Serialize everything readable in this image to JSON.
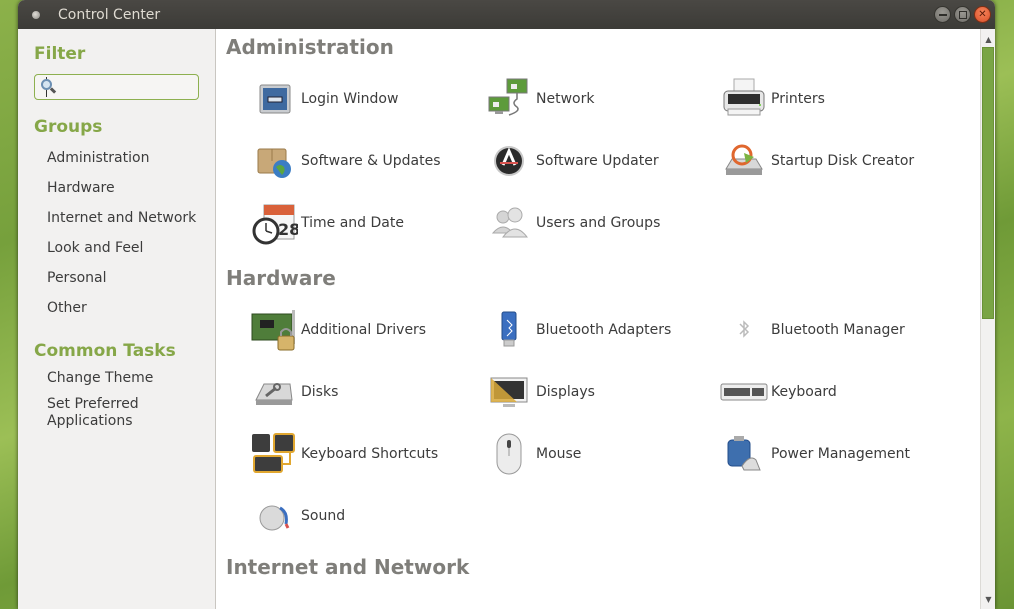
{
  "window": {
    "title": "Control Center",
    "buttons": {
      "minimize": "minimize",
      "maximize": "maximize",
      "close": "close"
    }
  },
  "sidebar": {
    "filter_heading": "Filter",
    "search": {
      "value": "",
      "placeholder": ""
    },
    "groups_heading": "Groups",
    "groups": [
      {
        "label": "Administration"
      },
      {
        "label": "Hardware"
      },
      {
        "label": "Internet and Network"
      },
      {
        "label": "Look and Feel"
      },
      {
        "label": "Personal"
      },
      {
        "label": "Other"
      }
    ],
    "tasks_heading": "Common Tasks",
    "tasks": [
      {
        "label": "Change Theme"
      },
      {
        "label": "Set Preferred Applications"
      }
    ]
  },
  "sections": {
    "administration": {
      "title": "Administration",
      "items": [
        {
          "label": "Login Window",
          "icon": "login-window-icon"
        },
        {
          "label": "Network",
          "icon": "network-icon"
        },
        {
          "label": "Printers",
          "icon": "printer-icon"
        },
        {
          "label": "Software & Updates",
          "icon": "software-updates-icon"
        },
        {
          "label": "Software Updater",
          "icon": "software-updater-icon"
        },
        {
          "label": "Startup Disk Creator",
          "icon": "startup-disk-icon"
        },
        {
          "label": "Time and Date",
          "icon": "time-date-icon"
        },
        {
          "label": "Users and Groups",
          "icon": "users-groups-icon"
        }
      ]
    },
    "hardware": {
      "title": "Hardware",
      "items": [
        {
          "label": "Additional Drivers",
          "icon": "additional-drivers-icon"
        },
        {
          "label": "Bluetooth Adapters",
          "icon": "bluetooth-adapter-icon"
        },
        {
          "label": "Bluetooth Manager",
          "icon": "bluetooth-icon"
        },
        {
          "label": "Disks",
          "icon": "disks-icon"
        },
        {
          "label": "Displays",
          "icon": "displays-icon"
        },
        {
          "label": "Keyboard",
          "icon": "keyboard-icon"
        },
        {
          "label": "Keyboard Shortcuts",
          "icon": "keyboard-shortcuts-icon"
        },
        {
          "label": "Mouse",
          "icon": "mouse-icon"
        },
        {
          "label": "Power Management",
          "icon": "power-management-icon"
        },
        {
          "label": "Sound",
          "icon": "sound-icon"
        }
      ]
    },
    "internet": {
      "title": "Internet and Network"
    }
  },
  "scrollbar": {
    "position_fraction": 0.0,
    "visible_fraction": 0.48
  },
  "colors": {
    "accent": "#86a748",
    "titlebar": "#3c3b37",
    "close_button": "#e9643a",
    "section_title": "#7f7e7a"
  }
}
